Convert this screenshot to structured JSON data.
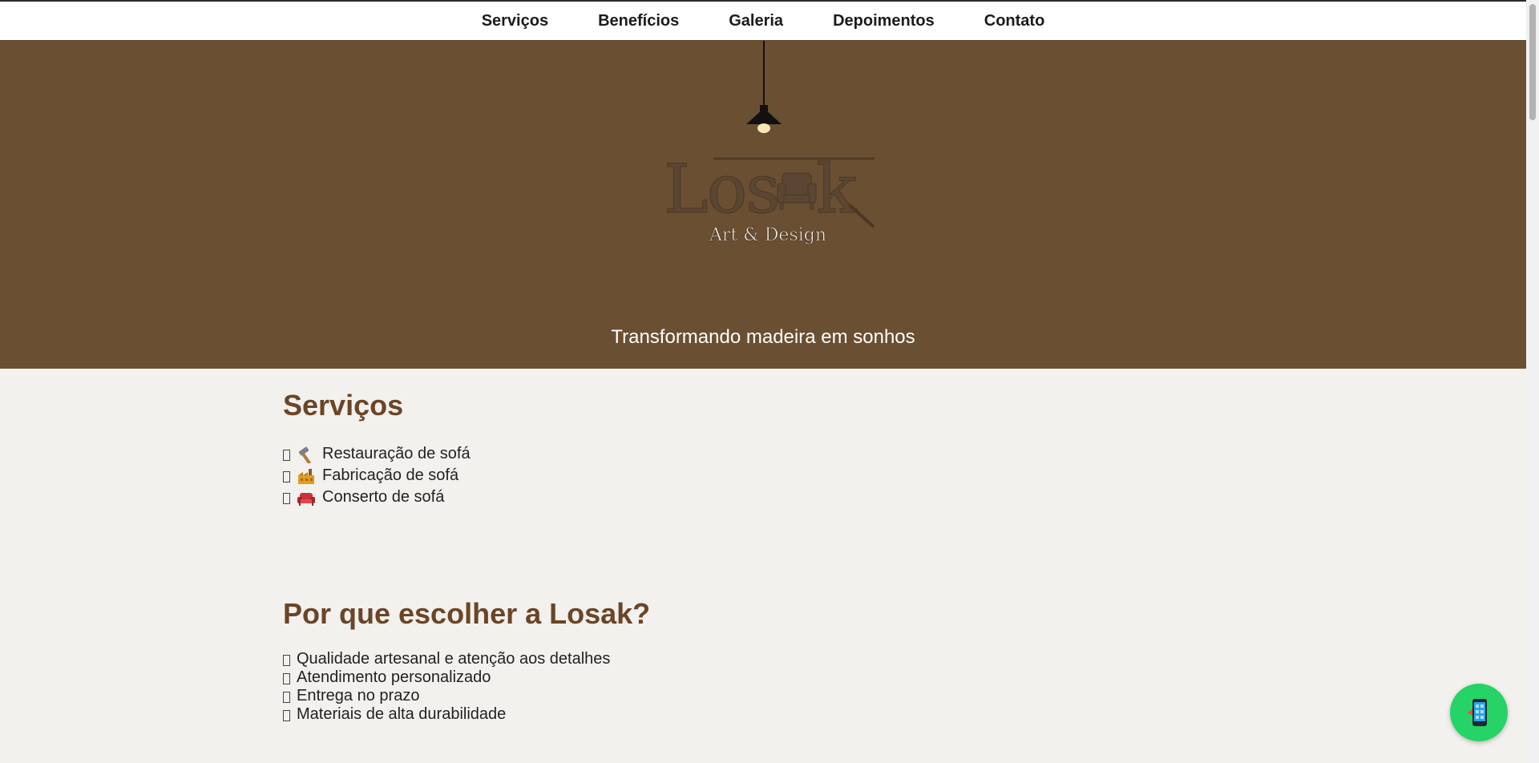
{
  "nav": {
    "items": [
      {
        "label": "Serviços"
      },
      {
        "label": "Benefícios"
      },
      {
        "label": "Galeria"
      },
      {
        "label": "Depoimentos"
      },
      {
        "label": "Contato"
      }
    ]
  },
  "hero": {
    "logo_text": "Losak",
    "logo_subtitle": "Art & Design",
    "tagline": "Transformando madeira em sonhos",
    "background_color": "#6b4f32"
  },
  "services": {
    "title": "Serviços",
    "items": [
      {
        "icon": "hammer-icon",
        "label": "Restauração de sofá"
      },
      {
        "icon": "factory-icon",
        "label": "Fabricação de sofá"
      },
      {
        "icon": "sofa-icon",
        "label": "Conserto de sofá"
      }
    ]
  },
  "benefits": {
    "title": "Por que escolher a Losak?",
    "items": [
      {
        "label": "Qualidade artesanal e atenção aos detalhes"
      },
      {
        "label": "Atendimento personalizado"
      },
      {
        "label": "Entrega no prazo"
      },
      {
        "label": "Materiais de alta durabilidade"
      }
    ]
  },
  "fab": {
    "icon": "mobile-phone-icon",
    "color": "#25d366"
  },
  "colors": {
    "heading": "#6b4526",
    "page_background": "#f3f1ee"
  }
}
